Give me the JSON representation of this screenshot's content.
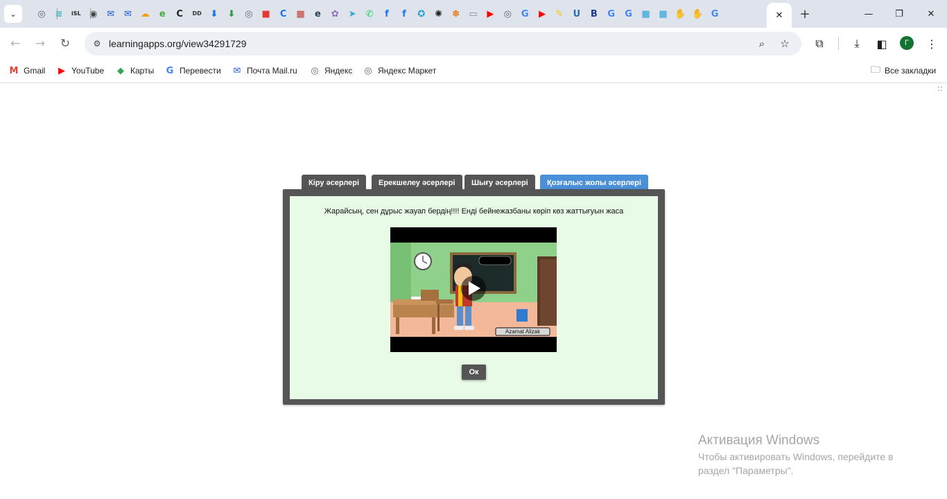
{
  "browser": {
    "pinned_tabs": [
      {
        "icon": "globe-icon",
        "glyph": "◎",
        "color": "#5f6368"
      },
      {
        "icon": "windsurf-icon",
        "glyph": "≋",
        "color": "#38b6c8"
      },
      {
        "icon": "isl-icon",
        "glyph": "iSL",
        "color": "#222222"
      },
      {
        "icon": "chrome-icon",
        "glyph": "◉",
        "color": "#444444"
      },
      {
        "icon": "mail-icon",
        "glyph": "✉",
        "color": "#1a5fd0"
      },
      {
        "icon": "mail-icon",
        "glyph": "✉",
        "color": "#1a5fd0"
      },
      {
        "icon": "cloud-icon",
        "glyph": "☁",
        "color": "#f39c12"
      },
      {
        "icon": "e-icon",
        "glyph": "e",
        "color": "#3cae3c"
      },
      {
        "icon": "c-icon",
        "glyph": "C",
        "color": "#222222"
      },
      {
        "icon": "dd-icon",
        "glyph": "DD",
        "color": "#333333"
      },
      {
        "icon": "download-icon",
        "glyph": "⬇",
        "color": "#1a73e8"
      },
      {
        "icon": "download-green-icon",
        "glyph": "⬇",
        "color": "#2e9e44"
      },
      {
        "icon": "globe-icon",
        "glyph": "◎",
        "color": "#5f6368"
      },
      {
        "icon": "stop-icon",
        "glyph": "■",
        "color": "#e53935"
      },
      {
        "icon": "c-blue-icon",
        "glyph": "C",
        "color": "#1a73e8"
      },
      {
        "icon": "qr-icon",
        "glyph": "▦",
        "color": "#c0392b"
      },
      {
        "icon": "e-dark-icon",
        "glyph": "e",
        "color": "#2c3e50"
      },
      {
        "icon": "puzzle-icon",
        "glyph": "✿",
        "color": "#8e6cc4"
      },
      {
        "icon": "telegram-icon",
        "glyph": "➤",
        "color": "#2ca5e0"
      },
      {
        "icon": "whatsapp-icon",
        "glyph": "✆",
        "color": "#25d366"
      },
      {
        "icon": "facebook-icon",
        "glyph": "f",
        "color": "#1877f2"
      },
      {
        "icon": "facebook-icon",
        "glyph": "f",
        "color": "#1877f2"
      },
      {
        "icon": "compass-icon",
        "glyph": "✪",
        "color": "#1a9fd8"
      },
      {
        "icon": "openai-icon",
        "glyph": "✺",
        "color": "#222222"
      },
      {
        "icon": "colorful-icon",
        "glyph": "✽",
        "color": "#e67e22"
      },
      {
        "icon": "whiteboard-icon",
        "glyph": "▭",
        "color": "#7f8c8d"
      },
      {
        "icon": "youtube-icon",
        "glyph": "▶",
        "color": "#ff0000"
      },
      {
        "icon": "globe-icon",
        "glyph": "◎",
        "color": "#5f6368"
      },
      {
        "icon": "google-icon",
        "glyph": "G",
        "color": "#4285f4"
      },
      {
        "icon": "youtube-icon",
        "glyph": "▶",
        "color": "#ff0000"
      },
      {
        "icon": "pencil-icon",
        "glyph": "✎",
        "color": "#f1c40f"
      },
      {
        "icon": "u-icon",
        "glyph": "U",
        "color": "#2b6cb0"
      },
      {
        "icon": "b-icon",
        "glyph": "B",
        "color": "#1e3a8a"
      },
      {
        "icon": "google-icon",
        "glyph": "G",
        "color": "#4285f4"
      },
      {
        "icon": "google-icon",
        "glyph": "G",
        "color": "#4285f4"
      },
      {
        "icon": "grid-icon",
        "glyph": "▦",
        "color": "#1a9fd8"
      },
      {
        "icon": "grid-icon",
        "glyph": "▦",
        "color": "#1a9fd8"
      },
      {
        "icon": "hand-icon",
        "glyph": "✋",
        "color": "#d4a017"
      },
      {
        "icon": "hand-icon",
        "glyph": "✋",
        "color": "#d4a017"
      },
      {
        "icon": "google-icon",
        "glyph": "G",
        "color": "#4285f4"
      }
    ],
    "active_tab_close": "✕",
    "new_tab": "+",
    "window_controls": {
      "minimize": "—",
      "maximize": "❐",
      "close": "✕"
    },
    "url": "learningapps.org/view34291729",
    "avatar_letter": "Г",
    "bookmarks": [
      {
        "label": "Gmail",
        "icon": "gmail-icon",
        "glyph": "M",
        "color": "#ea4335"
      },
      {
        "label": "YouTube",
        "icon": "youtube-icon",
        "glyph": "▶",
        "color": "#ff0000"
      },
      {
        "label": "Карты",
        "icon": "maps-icon",
        "glyph": "◆",
        "color": "#34a853"
      },
      {
        "label": "Перевести",
        "icon": "translate-icon",
        "glyph": "G",
        "color": "#4285f4"
      },
      {
        "label": "Почта Mail.ru",
        "icon": "mailru-icon",
        "glyph": "✉",
        "color": "#1a5fd0"
      },
      {
        "label": "Яндекс",
        "icon": "globe-icon",
        "glyph": "◎",
        "color": "#5f6368"
      },
      {
        "label": "Яндекс Маркет",
        "icon": "globe-icon",
        "glyph": "◎",
        "color": "#5f6368"
      }
    ],
    "all_bookmarks": "Все закладки"
  },
  "app": {
    "tabs": [
      {
        "label": "Кіру әсерлері",
        "active": false
      },
      {
        "label": "Ерекшелеу әсерлері",
        "active": false
      },
      {
        "label": "Шығу әсерлері",
        "active": false
      },
      {
        "label": "Қозғалыс жолы әсерлері",
        "active": true
      }
    ],
    "message": "Жарайсың, сен дұрыс жауап бердің!!!! Енді бейнежазбаны көріп көз жаттығуын жаса",
    "video_caption": "Azamat Alizak",
    "ok_label": "Ок",
    "colors": {
      "frame": "#555555",
      "panel_bg": "#e8fbe6",
      "active_tab": "#4a90d9"
    }
  },
  "watermark": {
    "title": "Активация Windows",
    "subtitle": "Чтобы активировать Windows, перейдите в раздел \"Параметры\"."
  }
}
